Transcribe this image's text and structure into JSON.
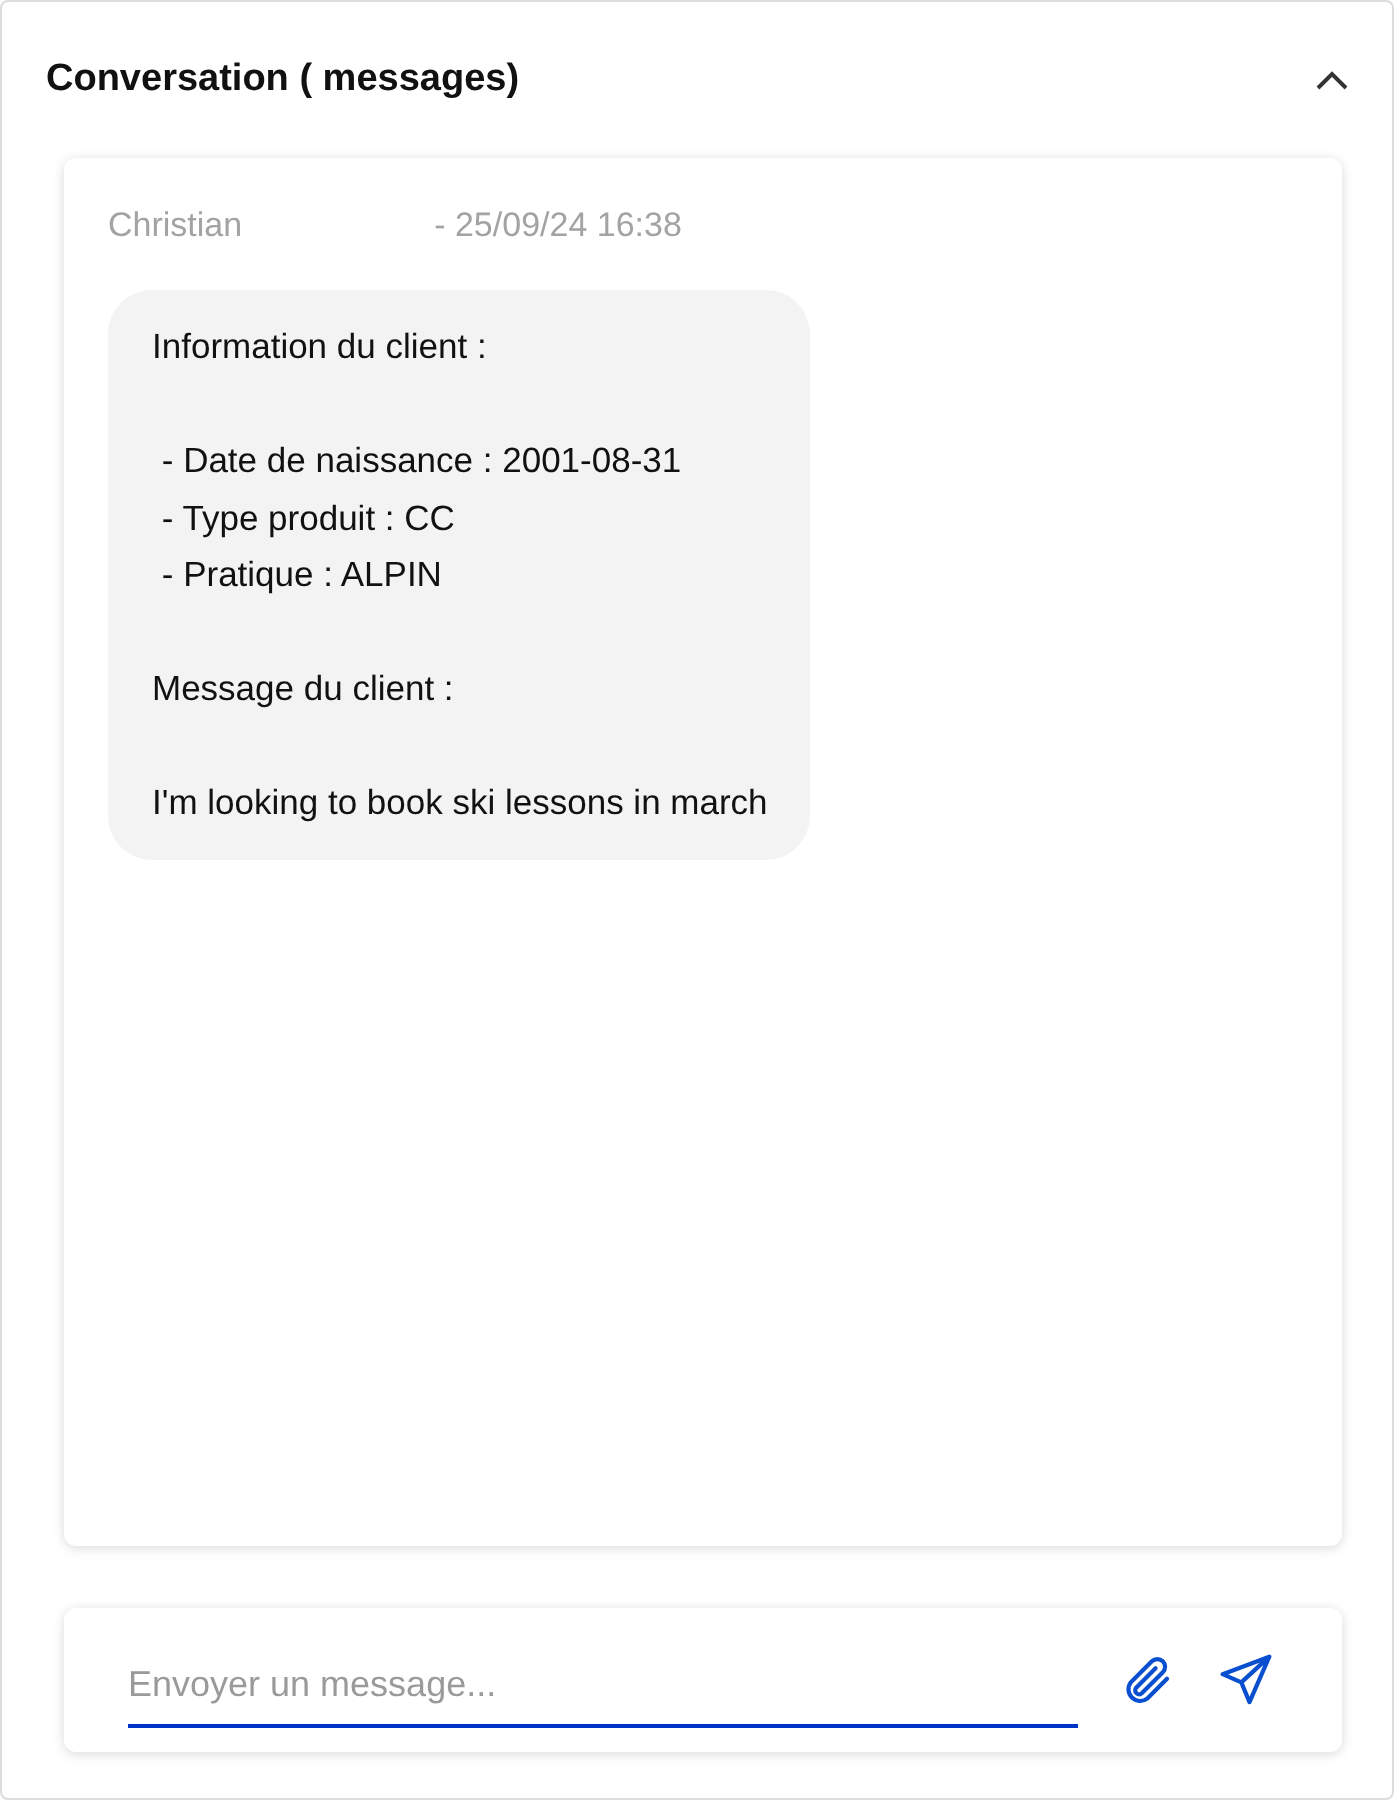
{
  "header": {
    "title": "Conversation ( messages)",
    "expanded": true
  },
  "messages": [
    {
      "author": "Christian",
      "timestamp": "- 25/09/24 16:38",
      "text": "Information du client :\n\n - Date de naissance : 2001-08-31\n - Type produit : CC\n - Pratique : ALPIN\n\nMessage du client :\n\nI'm looking to book ski lessons in march"
    }
  ],
  "composer": {
    "placeholder": "Envoyer un message..."
  }
}
